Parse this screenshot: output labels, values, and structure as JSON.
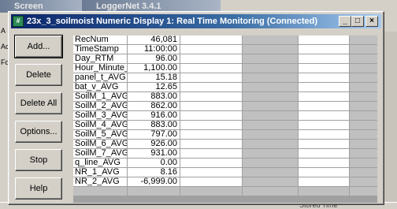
{
  "background": {
    "screen_title": "Screen",
    "loggernet_title": "LoggerNet 3.4.1",
    "left_tool_labels": [
      "A",
      "Ac",
      "Fo"
    ],
    "right_label": "MS",
    "status_text": "Stored Time"
  },
  "window": {
    "title": "23x_3_soilmoist Numeric Display 1: Real Time Monitoring (Connected)",
    "app_icon": "NUM",
    "controls": {
      "minimize": "_",
      "maximize": "□",
      "close": "×"
    }
  },
  "buttons": {
    "add": "Add...",
    "delete": "Delete",
    "delete_all": "Delete All",
    "options": "Options...",
    "stop": "Stop",
    "help": "Help"
  },
  "table": {
    "rows": [
      {
        "name": "RecNum",
        "value": "46,081"
      },
      {
        "name": "TimeStamp",
        "value": "11:00:00"
      },
      {
        "name": "Day_RTM",
        "value": "96.00"
      },
      {
        "name": "Hour_Minute_RTM",
        "value": "1,100.00"
      },
      {
        "name": "panel_t_AVG",
        "value": "15.18"
      },
      {
        "name": "bat_v_AVG",
        "value": "12.65"
      },
      {
        "name": "SoilM_1_AVG",
        "value": "883.00"
      },
      {
        "name": "SoilM_2_AVG",
        "value": "862.00"
      },
      {
        "name": "SoilM_3_AVG",
        "value": "916.00"
      },
      {
        "name": "SoilM_4_AVG",
        "value": "883.00"
      },
      {
        "name": "SoilM_5_AVG",
        "value": "797.00"
      },
      {
        "name": "SoilM_6_AVG",
        "value": "926.00"
      },
      {
        "name": "SoilM_7_AVG",
        "value": "931.00"
      },
      {
        "name": "q_line_AVG",
        "value": "0.00"
      },
      {
        "name": "NR_1_AVG",
        "value": "8.16"
      },
      {
        "name": "NR_2_AVG",
        "value": "-6,999.00"
      }
    ]
  },
  "colors": {
    "title_active": "#0a246a",
    "face": "#d4d0c8",
    "grid_empty": "#c0c0c0"
  }
}
